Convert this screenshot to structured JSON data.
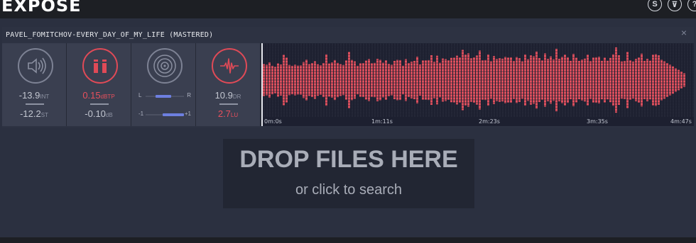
{
  "app": {
    "title": "EXPOSE"
  },
  "top_icons": [
    {
      "name": "s-icon",
      "glyph": "S"
    },
    {
      "name": "filter-icon",
      "glyph": "⊽"
    },
    {
      "name": "help-icon",
      "glyph": "?"
    }
  ],
  "track": {
    "title": "PAVEL_FOMITCHOV-EVERY_DAY_OF_MY_LIFE (MASTERED)",
    "close_glyph": "×",
    "loudness": {
      "int_value": "-13.9",
      "int_unit": "INT",
      "st_value": "-12.2",
      "st_unit": "ST"
    },
    "peak": {
      "value": "0.15",
      "unit": "dBTP",
      "db_value": "-0.10",
      "db_unit": "dB"
    },
    "stereo": {
      "balance_left_label": "L",
      "balance_right_label": "R",
      "correlation_left_label": "-1",
      "correlation_right_label": "+1"
    },
    "dynamics": {
      "dr_value": "10.9",
      "dr_unit": "DR",
      "lu_value": "2.7",
      "lu_unit": "LU"
    },
    "waveform": {
      "ticks": [
        "0m:0s",
        "1m:11s",
        "2m:23s",
        "3m:35s",
        "4m:47s"
      ],
      "color": "#e0505e"
    }
  },
  "dropzone": {
    "title": "DROP FILES HERE",
    "subtitle": "or click to search"
  }
}
